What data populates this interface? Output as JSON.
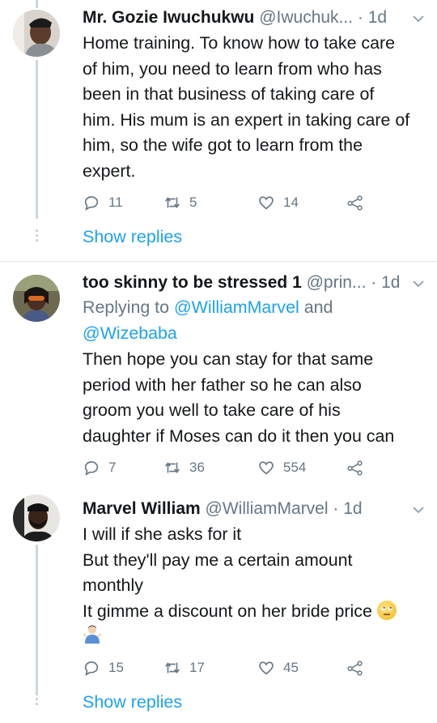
{
  "tweets": [
    {
      "name": "Mr. Gozie Iwuchukwu",
      "handle": "@Iwuchuk...",
      "time": "· 1d",
      "lines": [
        "Home training. To know how to take care",
        "of him, you need to learn from who has",
        "been in that business of taking care of",
        "him. His mum is an expert in taking care of",
        "him, so the wife got to learn from the",
        "expert."
      ],
      "replies": "11",
      "retweets": "5",
      "likes": "14",
      "show_replies": "Show replies"
    },
    {
      "name": "too skinny to be stressed 1",
      "handle": "@prin...",
      "time": "· 1d",
      "replying_prefix": "Replying to ",
      "replying_mention_1": "@WilliamMarvel",
      "replying_and": " and",
      "replying_mention_2": "@Wizebaba",
      "lines": [
        "Then hope you can stay for that same",
        "period with her father so he can also",
        "groom you well to take care of his",
        "daughter if Moses can do it then you can"
      ],
      "replies": "7",
      "retweets": "36",
      "likes": "554"
    },
    {
      "name": "Marvel William",
      "handle": "@WilliamMarvel",
      "time": "· 1d",
      "lines": [
        "I will if she asks for it",
        "But they'll pay me a certain amount",
        "monthly",
        "It gimme a discount on her bride price"
      ],
      "emojis": [
        "face-with-rolling-eyes-emoji",
        "person-shrugging-emoji"
      ],
      "replies": "15",
      "retweets": "17",
      "likes": "45",
      "show_replies": "Show replies"
    }
  ],
  "colors": {
    "accent": "#1da1f2",
    "secondary_text": "#657786",
    "divider": "#e1e8ed"
  }
}
